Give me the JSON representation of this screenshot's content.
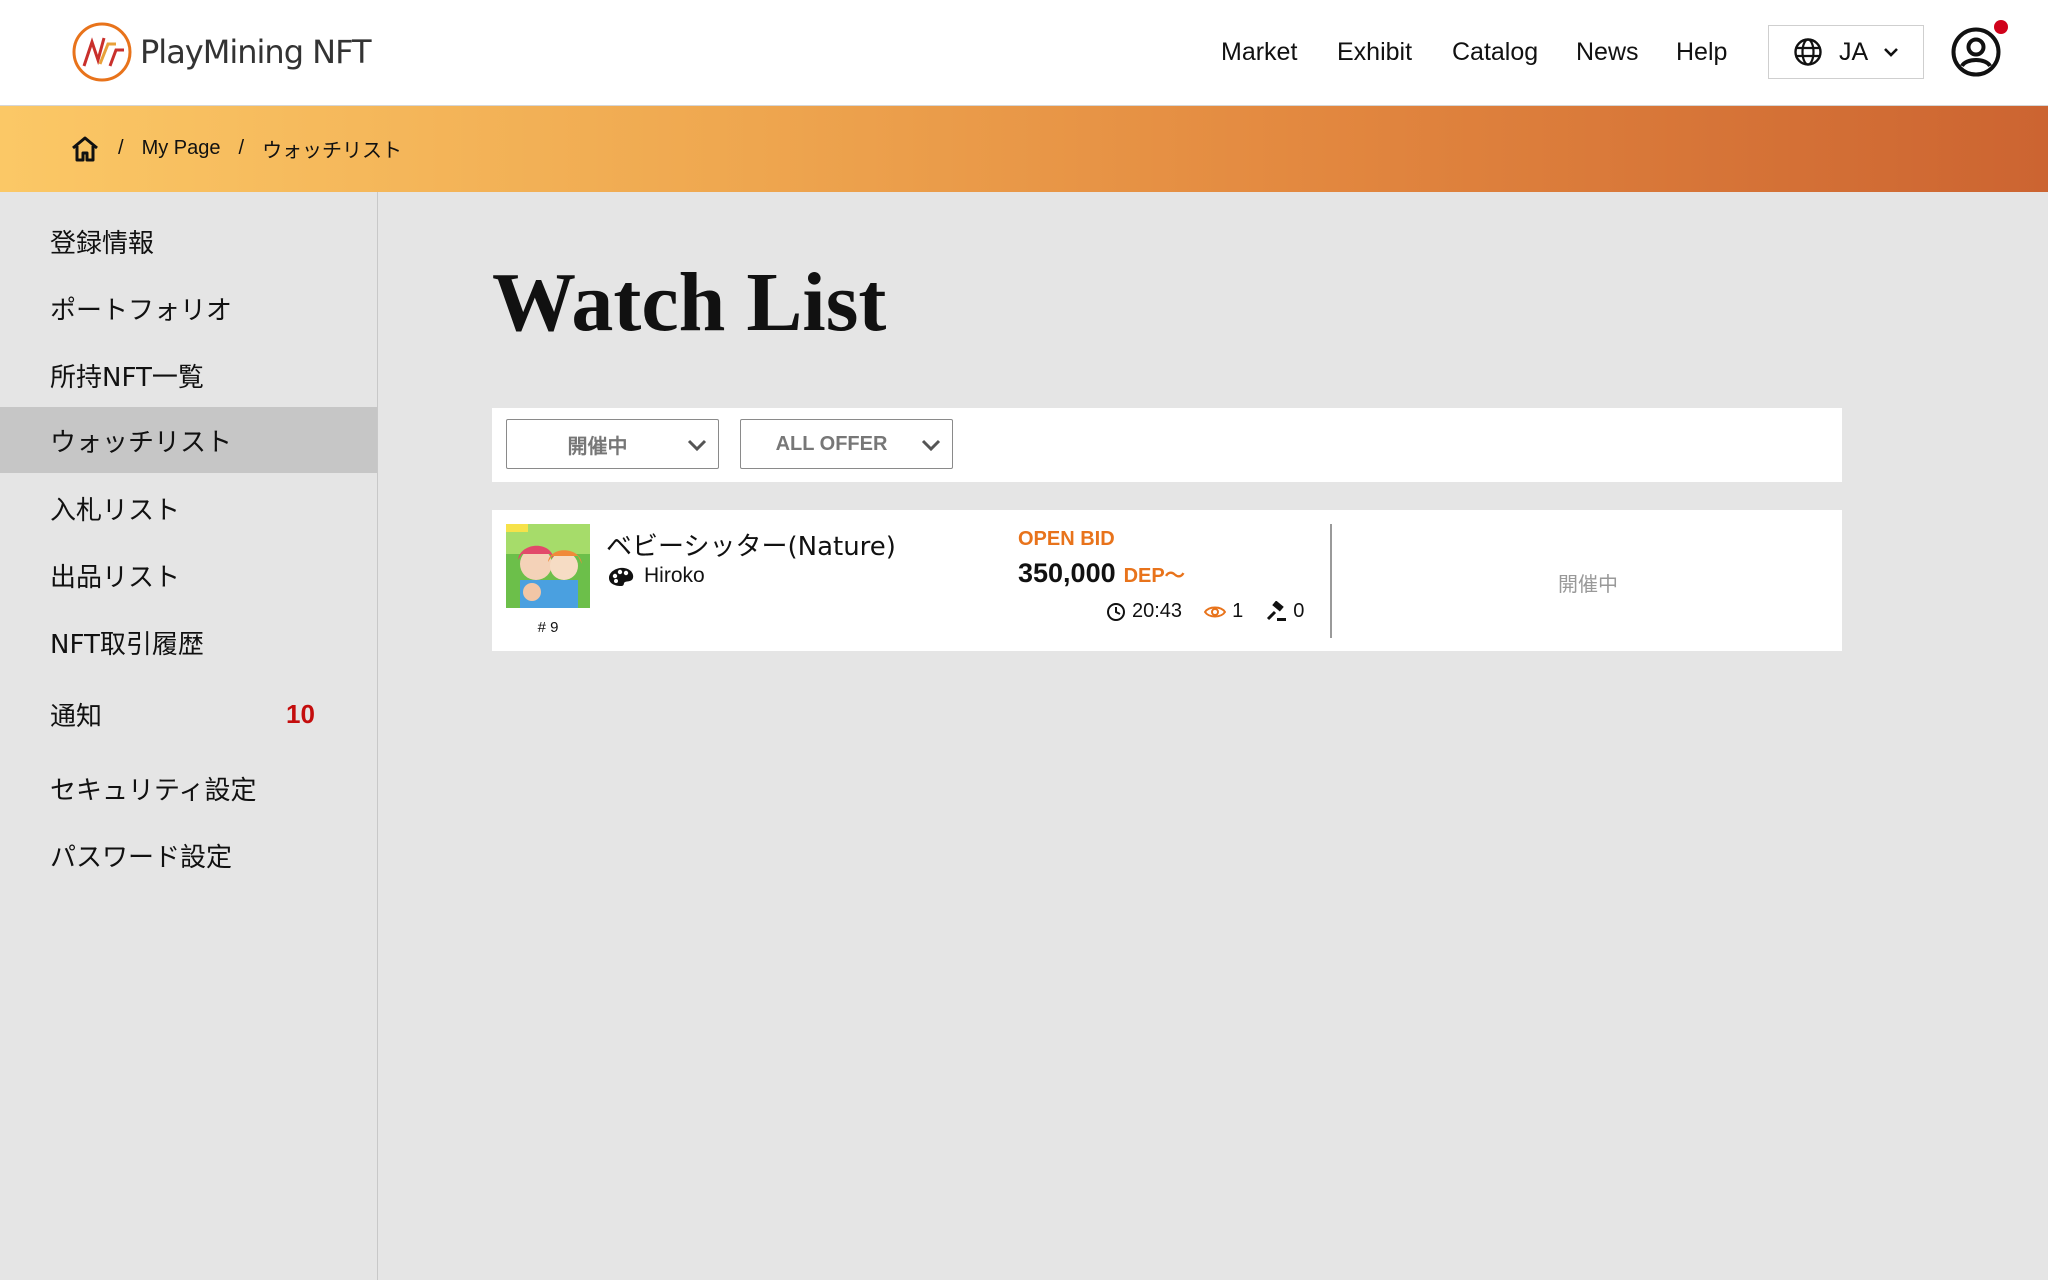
{
  "header": {
    "logo_text": "PlayMining NFT",
    "nav": [
      "Market",
      "Exhibit",
      "Catalog",
      "News",
      "Help"
    ],
    "language": "JA"
  },
  "breadcrumb": {
    "items": [
      "My Page",
      "ウォッチリスト"
    ]
  },
  "sidebar": {
    "items": [
      {
        "label": "登録情報"
      },
      {
        "label": "ポートフォリオ"
      },
      {
        "label": "所持NFT一覧"
      },
      {
        "label": "ウォッチリスト"
      },
      {
        "label": "入札リスト"
      },
      {
        "label": "出品リスト"
      },
      {
        "label": "NFT取引履歴"
      },
      {
        "label": "通知",
        "badge": "10"
      },
      {
        "label": "セキュリティ設定"
      },
      {
        "label": "パスワード設定"
      }
    ],
    "active_index": 3
  },
  "main": {
    "title": "Watch List",
    "filters": {
      "status_value": "開催中",
      "offer_value": "ALL OFFER"
    },
    "items": [
      {
        "token_id": "# 9",
        "name": "ベビーシッター(Nature)",
        "artist": "Hiroko",
        "bid_type": "OPEN BID",
        "price": "350,000",
        "price_unit": "DEP〜",
        "time_left": "20:43",
        "watch_count": "1",
        "bid_count": "0",
        "status": "開催中"
      }
    ]
  },
  "colors": {
    "accent_orange": "#e8731b",
    "badge_red": "#c40d0d",
    "banner_start": "#fbc866",
    "banner_end": "#cc6431"
  }
}
